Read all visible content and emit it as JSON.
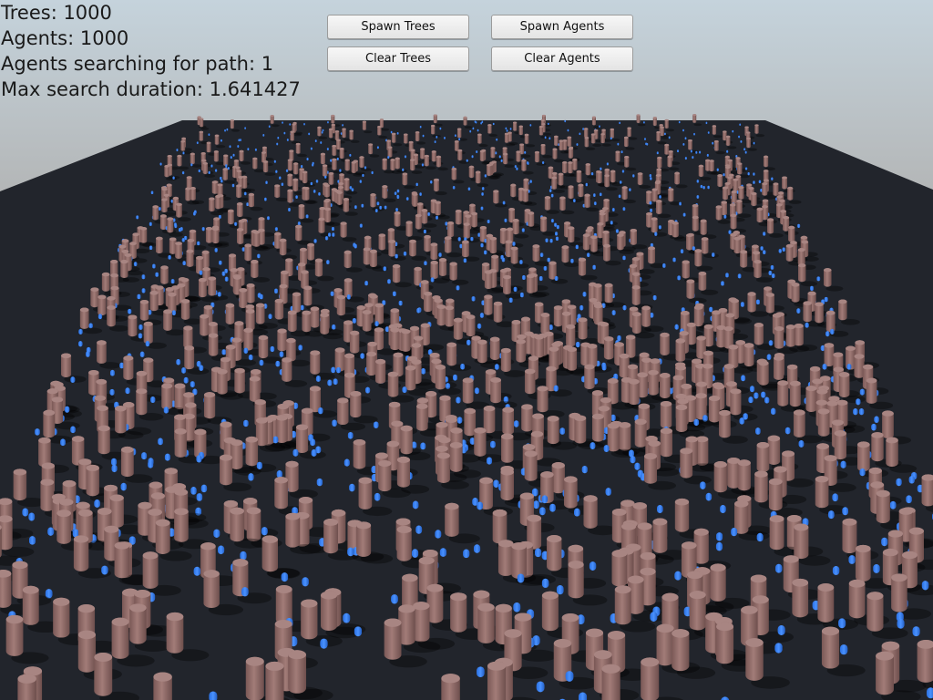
{
  "hud": {
    "trees": "Trees: 1000",
    "agents": "Agents: 1000",
    "searching": "Agents searching for path: 1",
    "max_duration": "Max search duration: 1.641427"
  },
  "buttons": {
    "spawn_trees": "Spawn Trees",
    "spawn_agents": "Spawn Agents",
    "clear_trees": "Clear Trees",
    "clear_agents": "Clear Agents"
  },
  "scene": {
    "colors": {
      "sky_top": "#9db7c9",
      "horizon": "#8a7f78",
      "ground": "#22252c",
      "tree": "#8f6b68",
      "tree_shadow": "#5e4442",
      "agent": "#2f7bf2"
    },
    "tree_count": 1000,
    "agent_count": 1000
  }
}
